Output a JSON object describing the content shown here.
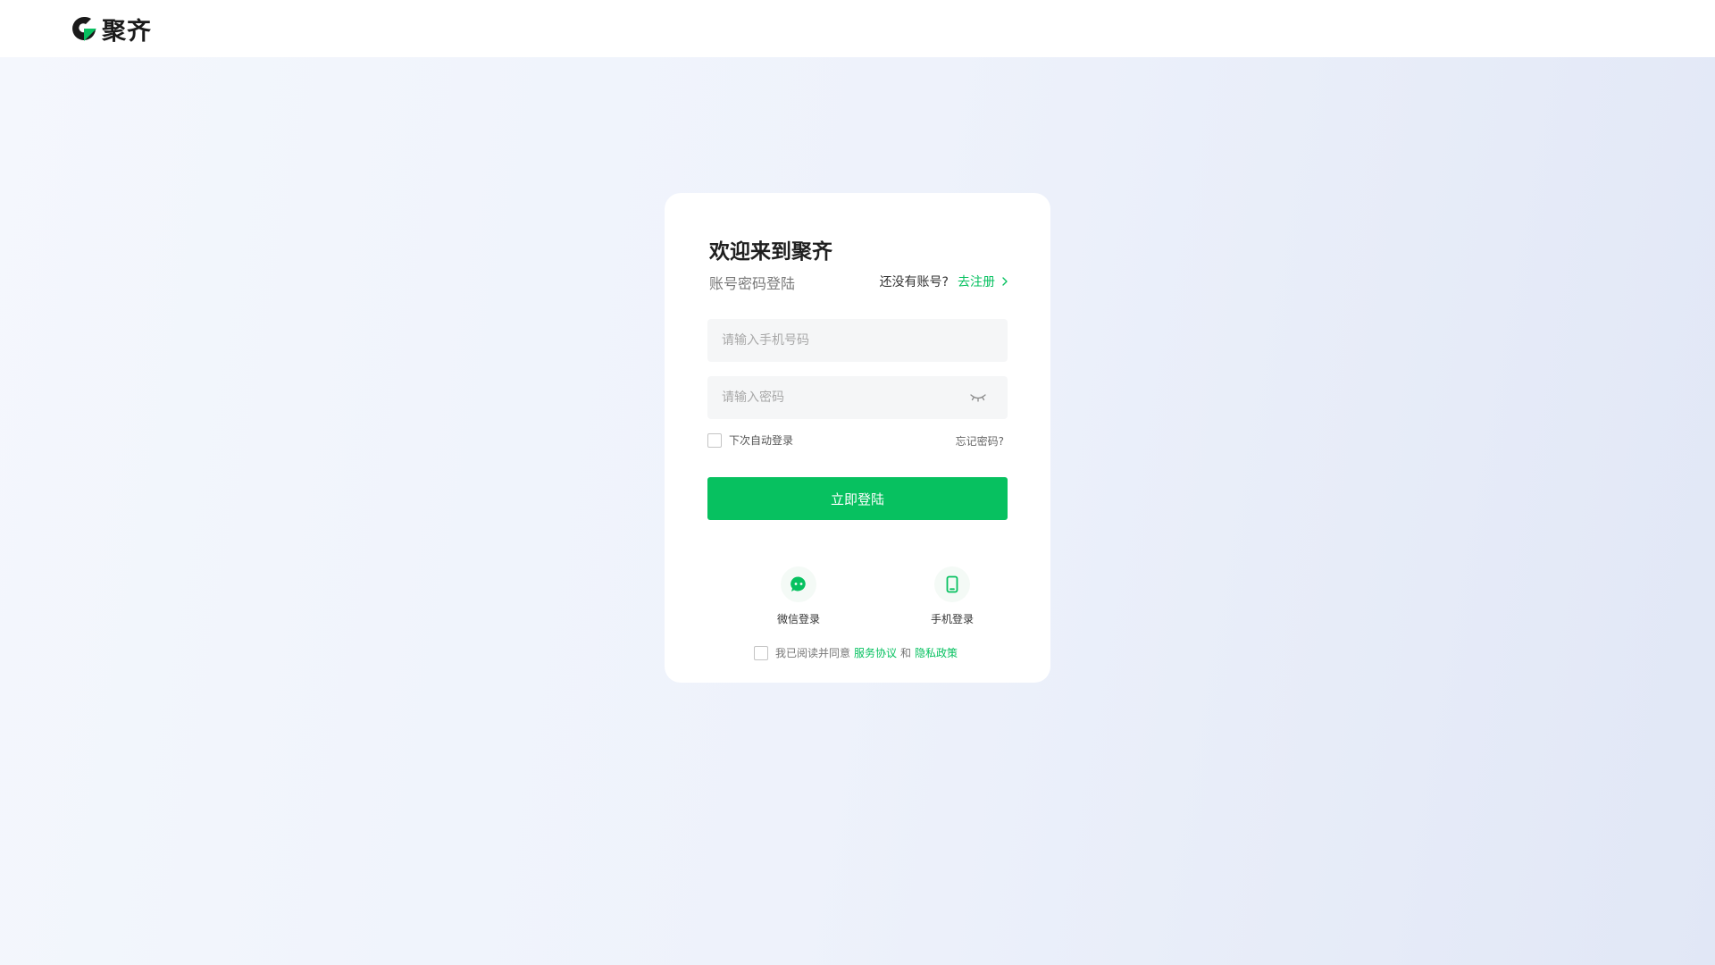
{
  "brand": {
    "name": "聚齐",
    "accent_color": "#07c160",
    "logo_icon": "brand-logo-icon"
  },
  "login": {
    "title": "欢迎来到聚齐",
    "subtitle": "账号密码登陆",
    "register_prompt": "还没有账号?",
    "register_link": "去注册",
    "phone_placeholder": "请输入手机号码",
    "phone_value": "",
    "password_placeholder": "请输入密码",
    "password_value": "",
    "password_toggle_icon": "eye-closed-icon",
    "remember_label": "下次自动登录",
    "remember_checked": false,
    "forgot_link": "忘记密码?",
    "submit_label": "立即登陆"
  },
  "alt_login": [
    {
      "label": "微信登录",
      "icon": "wechat-icon"
    },
    {
      "label": "手机登录",
      "icon": "mobile-phone-icon"
    }
  ],
  "agreement": {
    "prefix": "我已阅读并同意",
    "service_link": "服务协议",
    "conjunction": "和",
    "privacy_link": "隐私政策",
    "checked": false
  }
}
